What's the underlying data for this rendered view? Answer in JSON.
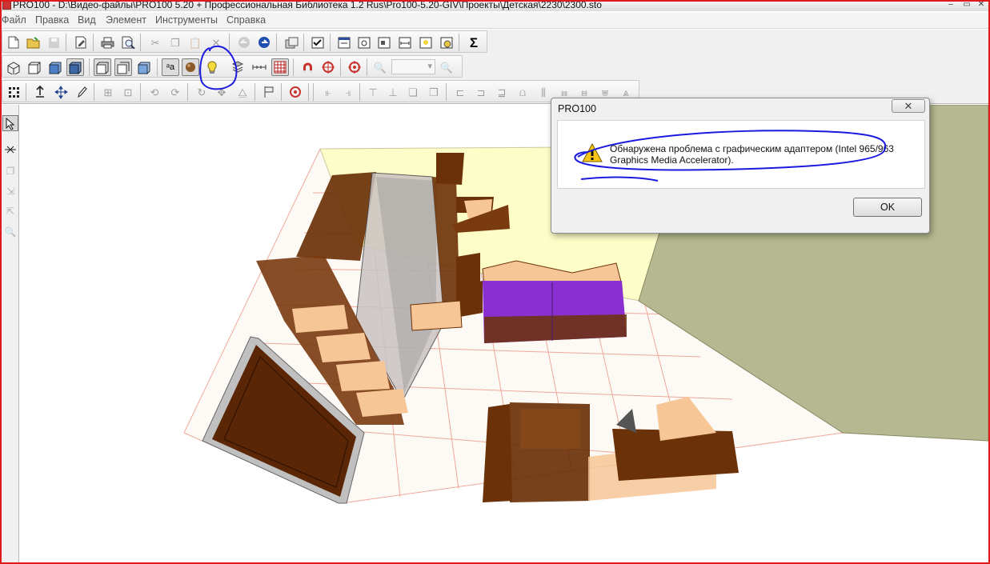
{
  "window": {
    "title": "PRO100 - D:\\Видео-файлы\\PRO100 5.20 + Профессиональная Библиотека 1.2 Rus\\Pro100-5.20-GIV\\Проекты\\Детская\\2230\\2300.sto"
  },
  "menu": {
    "items": [
      "Файл",
      "Правка",
      "Вид",
      "Элемент",
      "Инструменты",
      "Справка"
    ]
  },
  "toolbar": {
    "zoom_value": "",
    "sum_symbol": "Σ",
    "text_mode_label": "a"
  },
  "dialog": {
    "title": "PRO100",
    "close_symbol": "✕",
    "message": "Обнаружена проблема с графическим адаптером (Intel 965/963 Graphics Media Accelerator).",
    "ok_label": "OK",
    "icon": "warning-icon"
  },
  "colors": {
    "annotation_blue": "#1a1adf",
    "frame_red": "#e01a1a",
    "furniture_brown": "#6b3108",
    "sofa_purple": "#8a2fd0",
    "back_wall": "#fdfdc8",
    "side_wall": "#b5b890"
  }
}
